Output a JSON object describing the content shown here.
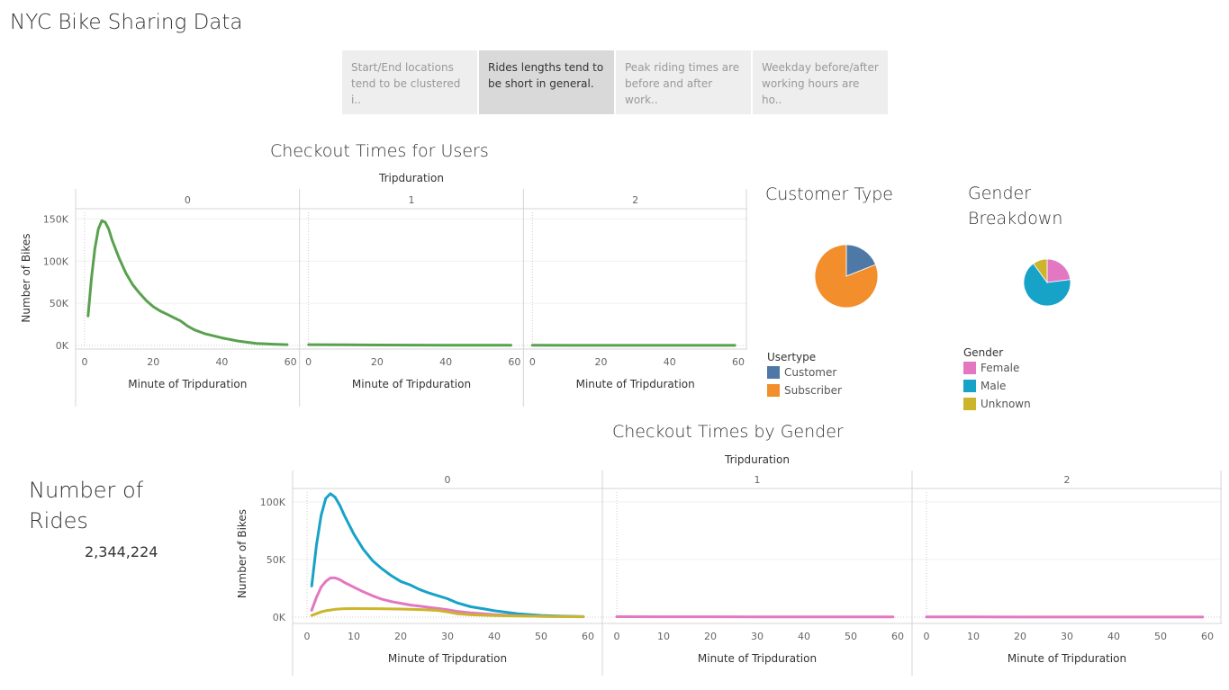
{
  "dashboard": {
    "title": "NYC Bike Sharing Data",
    "story_tabs": [
      {
        "label": "Start/End locations tend to be clustered i..",
        "active": false
      },
      {
        "label": "Rides lengths tend to be short in general.",
        "active": true
      },
      {
        "label": "Peak riding times are before and after work..",
        "active": false
      },
      {
        "label": "Weekday before/after working hours are ho..",
        "active": false
      }
    ]
  },
  "customer_type": {
    "title": "Customer Type",
    "legend_title": "Usertype",
    "legend": [
      {
        "label": "Customer",
        "color": "#4e79a7"
      },
      {
        "label": "Subscriber",
        "color": "#f28e2b"
      }
    ]
  },
  "gender_breakdown": {
    "title": "Gender Breakdown",
    "legend_title": "Gender",
    "legend": [
      {
        "label": "Female",
        "color": "#e377c2"
      },
      {
        "label": "Male",
        "color": "#17a2c8"
      },
      {
        "label": "Unknown",
        "color": "#cdb52b"
      }
    ]
  },
  "number_of_rides": {
    "label": "Number of Rides",
    "value": "2,344,224"
  },
  "chart_data": [
    {
      "type": "line",
      "title": "Checkout Times for Users",
      "column_header": "Tripduration",
      "panels": [
        "0",
        "1",
        "2"
      ],
      "xlabel": "Minute of Tripduration",
      "ylabel": "Number of Bikes",
      "xlim": [
        0,
        60
      ],
      "ylim": [
        0,
        160000
      ],
      "xticks": [
        "0",
        "20",
        "40",
        "60"
      ],
      "yticks": [
        "0K",
        "50K",
        "100K",
        "150K"
      ],
      "color": "#59a14f",
      "series": [
        {
          "panel": "0",
          "x": [
            1,
            2,
            3,
            4,
            5,
            6,
            7,
            8,
            10,
            12,
            14,
            16,
            18,
            20,
            22,
            24,
            26,
            28,
            30,
            32,
            35,
            38,
            40,
            45,
            50,
            55,
            59
          ],
          "y": [
            35000,
            80000,
            115000,
            138000,
            148000,
            146000,
            138000,
            125000,
            104000,
            86000,
            72000,
            62000,
            53000,
            46000,
            41000,
            37000,
            33000,
            29000,
            23000,
            18500,
            14000,
            11000,
            9000,
            5000,
            2500,
            1500,
            1000
          ]
        },
        {
          "panel": "1",
          "x": [
            0,
            10,
            20,
            30,
            40,
            50,
            59
          ],
          "y": [
            1000,
            700,
            500,
            400,
            300,
            250,
            200
          ]
        },
        {
          "panel": "2",
          "x": [
            0,
            10,
            20,
            30,
            40,
            50,
            59
          ],
          "y": [
            200,
            150,
            120,
            100,
            90,
            80,
            70
          ]
        }
      ]
    },
    {
      "type": "pie",
      "title": "Customer Type",
      "values": [
        {
          "label": "Customer",
          "value": 0.19
        },
        {
          "label": "Subscriber",
          "value": 0.81
        }
      ]
    },
    {
      "type": "pie",
      "title": "Gender Breakdown",
      "values": [
        {
          "label": "Female",
          "value": 0.23
        },
        {
          "label": "Male",
          "value": 0.67
        },
        {
          "label": "Unknown",
          "value": 0.1
        }
      ]
    },
    {
      "type": "line",
      "title": "Checkout Times by Gender",
      "column_header": "Tripduration",
      "panels": [
        "0",
        "1",
        "2"
      ],
      "xlabel": "Minute of Tripduration",
      "ylabel": "Number of Bikes",
      "xlim": [
        0,
        60
      ],
      "ylim": [
        0,
        110000
      ],
      "xticks": [
        "0",
        "10",
        "20",
        "30",
        "40",
        "50",
        "60"
      ],
      "yticks": [
        "0K",
        "50K",
        "100K"
      ],
      "series": [
        {
          "name": "Male",
          "panel": "0",
          "color": "#17a2c8",
          "x": [
            1,
            2,
            3,
            4,
            5,
            6,
            7,
            8,
            10,
            12,
            14,
            16,
            18,
            20,
            22,
            24,
            26,
            28,
            30,
            32,
            35,
            38,
            40,
            45,
            50,
            55,
            59
          ],
          "y": [
            27000,
            62000,
            88000,
            103000,
            107000,
            104000,
            97000,
            88000,
            72000,
            59000,
            49000,
            42000,
            36000,
            31000,
            28000,
            24000,
            21000,
            18500,
            16000,
            12500,
            9000,
            7000,
            5500,
            3000,
            1500,
            800,
            500
          ]
        },
        {
          "name": "Female",
          "panel": "0",
          "color": "#e377c2",
          "x": [
            1,
            2,
            3,
            4,
            5,
            6,
            7,
            8,
            10,
            12,
            14,
            16,
            18,
            20,
            22,
            24,
            26,
            28,
            30,
            32,
            35,
            38,
            40,
            45,
            50,
            55,
            59
          ],
          "y": [
            6000,
            17000,
            26000,
            31000,
            34000,
            34000,
            32500,
            30000,
            26000,
            22000,
            18500,
            15500,
            13500,
            12000,
            10500,
            9500,
            8500,
            7500,
            6500,
            5000,
            3700,
            2800,
            2200,
            1200,
            700,
            400,
            300
          ]
        },
        {
          "name": "Unknown",
          "panel": "0",
          "color": "#cdb52b",
          "x": [
            1,
            2,
            3,
            4,
            5,
            6,
            8,
            10,
            15,
            20,
            25,
            28,
            30,
            32,
            35,
            40,
            45,
            50,
            55,
            59
          ],
          "y": [
            1500,
            3000,
            4500,
            5500,
            6200,
            6800,
            7300,
            7400,
            7300,
            7000,
            6500,
            5800,
            4500,
            3000,
            2000,
            1400,
            1000,
            700,
            500,
            400
          ]
        },
        {
          "name": "Female",
          "panel": "1",
          "color": "#e377c2",
          "x": [
            0,
            10,
            20,
            30,
            40,
            50,
            59
          ],
          "y": [
            400,
            350,
            300,
            250,
            200,
            180,
            150
          ]
        },
        {
          "name": "Female",
          "panel": "2",
          "color": "#e377c2",
          "x": [
            0,
            10,
            20,
            30,
            40,
            50,
            59
          ],
          "y": [
            150,
            120,
            100,
            90,
            80,
            70,
            60
          ]
        }
      ]
    }
  ]
}
